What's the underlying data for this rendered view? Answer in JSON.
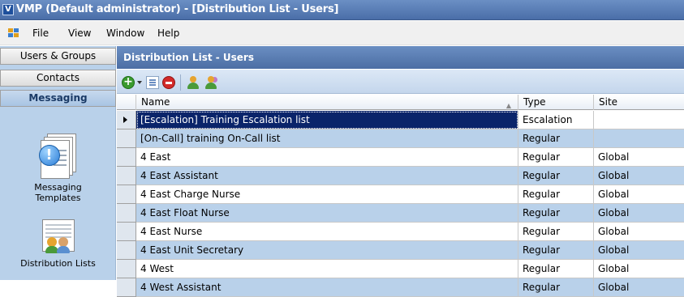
{
  "window": {
    "title": "VMP (Default administrator) - [Distribution List - Users]",
    "icon_letter": "V"
  },
  "menu": {
    "items": [
      "File",
      "View",
      "Window",
      "Help"
    ]
  },
  "nav": {
    "buttons": [
      {
        "label": "Users & Groups"
      },
      {
        "label": "Contacts"
      },
      {
        "label": "Messaging"
      }
    ],
    "active": "Messaging",
    "tiles": [
      {
        "label_line1": "Messaging",
        "label_line2": "Templates",
        "icon": "messaging-templates-icon"
      },
      {
        "label_line1": "Distribution Lists",
        "icon": "distribution-lists-icon"
      }
    ]
  },
  "panel": {
    "title": "Distribution List - Users"
  },
  "toolbar": {
    "buttons": [
      "add-icon",
      "edit-icon",
      "delete-icon",
      "user-icon",
      "users-icon"
    ]
  },
  "grid": {
    "columns": {
      "name": "Name",
      "type": "Type",
      "site": "Site"
    },
    "rows": [
      {
        "name": "[Escalation] Training Escalation list",
        "type": "Escalation",
        "site": ""
      },
      {
        "name": "[On-Call] training On-Call list",
        "type": "Regular",
        "site": ""
      },
      {
        "name": "4 East",
        "type": "Regular",
        "site": "Global"
      },
      {
        "name": "4 East Assistant",
        "type": "Regular",
        "site": "Global"
      },
      {
        "name": "4 East Charge Nurse",
        "type": "Regular",
        "site": "Global"
      },
      {
        "name": "4 East Float Nurse",
        "type": "Regular",
        "site": "Global"
      },
      {
        "name": "4 East Nurse",
        "type": "Regular",
        "site": "Global"
      },
      {
        "name": "4 East Unit Secretary",
        "type": "Regular",
        "site": "Global"
      },
      {
        "name": "4 West",
        "type": "Regular",
        "site": "Global"
      },
      {
        "name": "4 West Assistant",
        "type": "Regular",
        "site": "Global"
      }
    ]
  },
  "colors": {
    "selection": "#0a246a",
    "alt_row": "#b9d1ea",
    "header": "#4c6ea4"
  }
}
